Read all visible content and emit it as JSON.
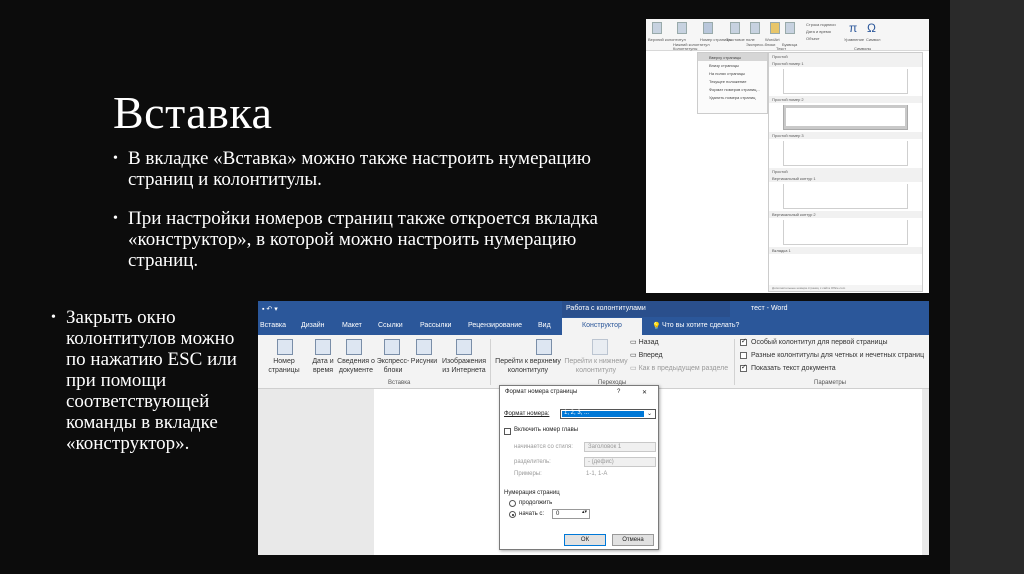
{
  "slide": {
    "title": "Вставка",
    "bullet1": "В вкладке «Вставка» можно также настроить нумерацию страниц и колонтитулы.",
    "bullet2": "При настройки номеров страниц также откроется вкладка «конструктор», в которой можно настроить нумерацию страниц.",
    "bullet3": "Закрыть окно колонтитулов можно по нажатию ESC или при помощи соответствующей команды в вкладке «конструктор»."
  },
  "screen1": {
    "ribbon_labels": [
      "Верхний колонтитул",
      "Нижний колонтитул",
      "Номер страницы",
      "Текстовое поле",
      "Экспресс-блоки",
      "WordArt",
      "Буквица",
      "Строка подписи",
      "Дата и время",
      "Объект",
      "Уравнение",
      "Символ"
    ],
    "group_labels": [
      "Колонтитулы",
      "Текст",
      "Символы"
    ],
    "menu_items": [
      "Вверху страницы",
      "Внизу страницы",
      "На полях страницы",
      "Текущее положение",
      "Формат номеров страниц...",
      "Удалить номера страниц"
    ],
    "gallery_header": "Простой",
    "gallery_items": [
      "Простой номер 1",
      "Простой номер 2",
      "Простой номер 3",
      "Простой",
      "Вертикальный контур 1",
      "Вертикальный контур 2",
      "Вкладка 1"
    ],
    "gallery_footer": "Дополнительные номера страниц с сайта Office.com"
  },
  "screen2": {
    "title_bar": {
      "context": "Работа с колонтитулами",
      "doc": "тест - Word"
    },
    "tabs": [
      "Вставка",
      "Дизайн",
      "Макет",
      "Ссылки",
      "Рассылки",
      "Рецензирование",
      "Вид",
      "Конструктор"
    ],
    "tell_me": "Что вы хотите сделать?",
    "ribbon": {
      "page_number": "Номер страницы",
      "date_time": "Дата и время",
      "doc_info": "Сведения о документе",
      "express": "Экспресс-блоки",
      "pictures": "Рисунки",
      "online_pictures": "Изображения из Интернета",
      "goto_header": "Перейти к верхнему колонтитулу",
      "goto_footer": "Перейти к нижнему колонтитулу",
      "back": "Назад",
      "forward": "Вперед",
      "link_prev": "Как в предыдущем разделе",
      "group_insert": "Вставка",
      "group_transitions": "Переходы",
      "group_params": "Параметры",
      "opt1": "Особый колонтитул для первой страницы",
      "opt2": "Разные колонтитулы для четных и нечетных страниц",
      "opt3": "Показать текст документа"
    },
    "dialog": {
      "title": "Формат номера страницы",
      "help": "?",
      "close": "✕",
      "number_format_label": "Формат номера:",
      "number_format_value": "1, 2, 3, ...",
      "include_chapter": "Включить номер главы",
      "starts_with_style_label": "начинается со стиля:",
      "starts_with_style_value": "Заголовок 1",
      "separator_label": "разделитель:",
      "separator_value": "-   (дефис)",
      "examples_label": "Примеры:",
      "examples_value": "1-1, 1-A",
      "numbering_label": "Нумерация страниц",
      "continue": "продолжить",
      "start_at": "начать с:",
      "start_value": "0",
      "ok": "ОК",
      "cancel": "Отмена"
    }
  }
}
